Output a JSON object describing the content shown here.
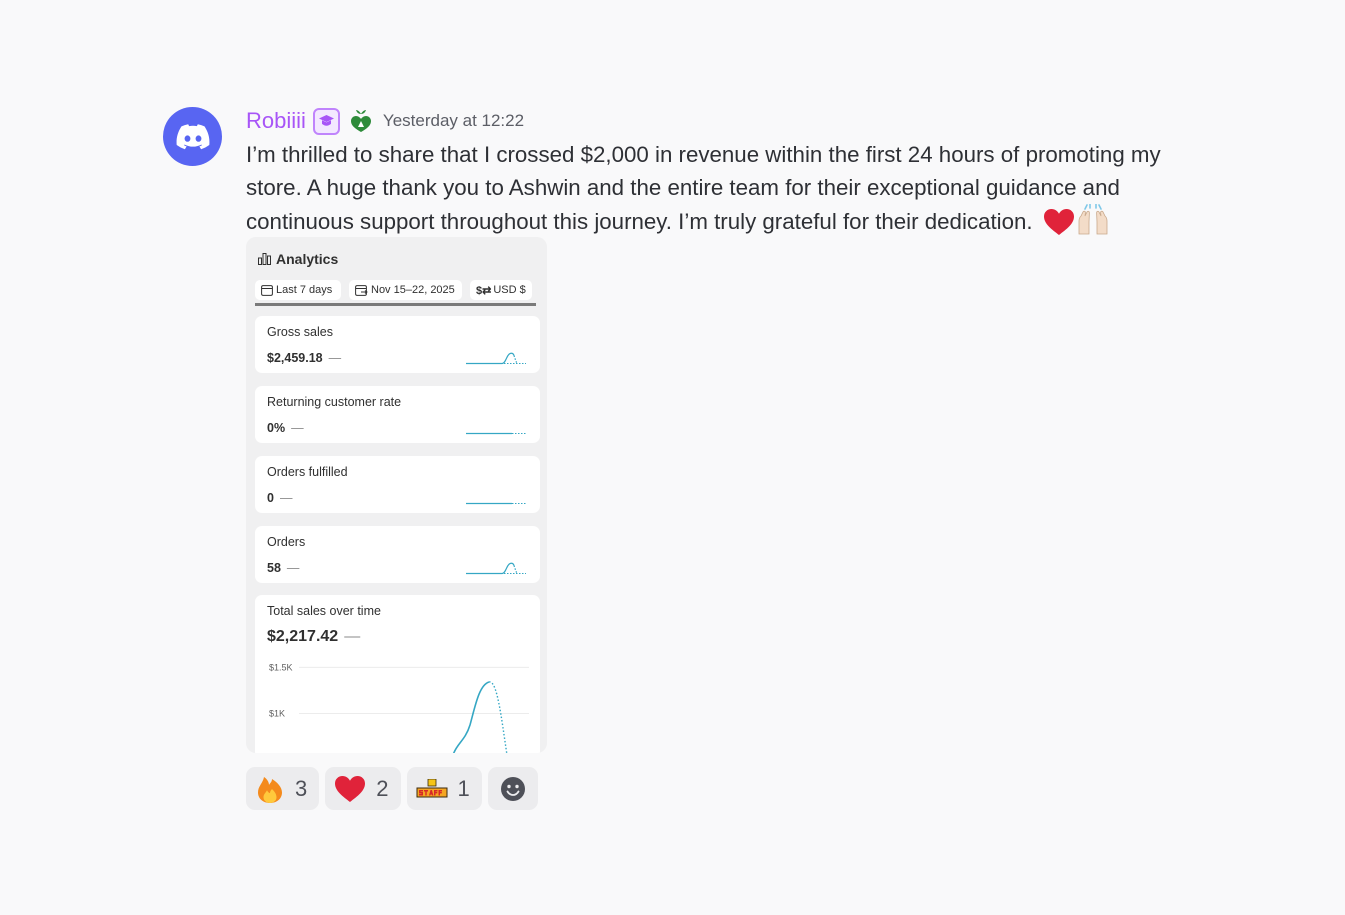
{
  "message": {
    "username": "Robiiii",
    "timestamp": "Yesterday at 12:22",
    "text": "I’m thrilled to share that I crossed $2,000 in revenue within the first 24 hours of promoting my store. A huge thank you to Ashwin and the entire team for their exceptional guidance and continuous support throughout this journey.  I’m truly grateful for their dedication.",
    "avatar_icon": "discord-icon",
    "badges": [
      "graduation-cap-icon",
      "green-heart-leaf-icon"
    ]
  },
  "embed": {
    "title": "Analytics",
    "filters": [
      {
        "label": "Last 7 days",
        "icon": "calendar-icon"
      },
      {
        "label": "Nov 15–22, 2025",
        "icon": "calendar-compare-icon"
      },
      {
        "label": "USD $",
        "icon": "currency-icon"
      }
    ],
    "metrics": [
      {
        "label": "Gross sales",
        "value": "$2,459.18"
      },
      {
        "label": "Returning customer rate",
        "value": "0%"
      },
      {
        "label": "Orders fulfilled",
        "value": "0"
      },
      {
        "label": "Orders",
        "value": "58"
      }
    ],
    "total": {
      "label": "Total sales over time",
      "value": "$2,217.42"
    },
    "dash": "—",
    "accent": "#35a7c4"
  },
  "chart_data": {
    "type": "line",
    "title": "Total sales over time",
    "ytick_labels": [
      "$1.5K",
      "$1K"
    ],
    "yticks": [
      1500,
      1000
    ],
    "series": [
      {
        "values": [
          [
            0,
            0
          ],
          [
            1,
            0
          ],
          [
            2,
            0
          ],
          [
            3,
            0
          ],
          [
            4,
            0
          ],
          [
            5,
            400
          ],
          [
            6,
            1300
          ],
          [
            7,
            620
          ]
        ]
      }
    ],
    "grid": true
  },
  "reactions": [
    {
      "emoji": "fire-icon",
      "count": "3"
    },
    {
      "emoji": "red-heart-icon",
      "count": "2"
    },
    {
      "emoji": "staff-badge-icon",
      "count": "1"
    }
  ],
  "add_reaction_icon": "smiley-icon"
}
